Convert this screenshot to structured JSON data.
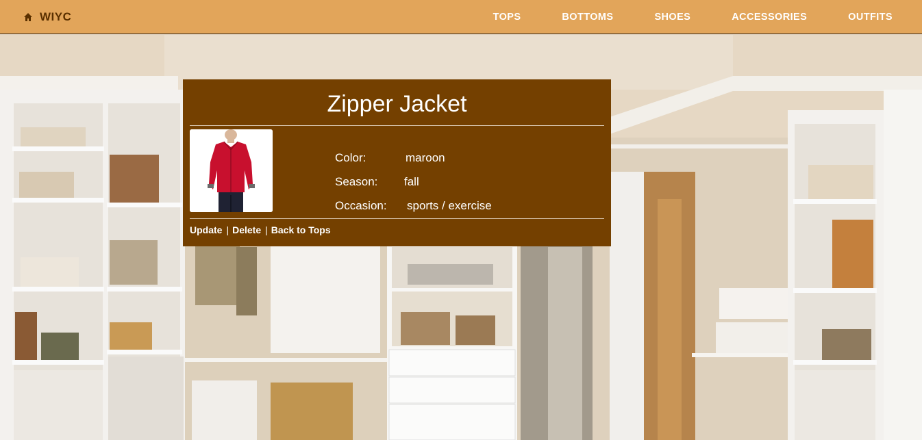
{
  "navbar": {
    "brand": "WIYC",
    "brand_icon": "home-icon",
    "links": [
      "TOPS",
      "BOTTOMS",
      "SHOES",
      "ACCESSORIES",
      "OUTFITS"
    ]
  },
  "colors": {
    "navbar_bg": "#e2a55a",
    "card_bg": "#744000",
    "item_color": "#c8102e"
  },
  "item": {
    "name": "Zipper Jacket",
    "image_alt": "red zipper jacket",
    "attributes": [
      {
        "label": "Color:",
        "value": "maroon"
      },
      {
        "label": "Season:",
        "value": "fall"
      },
      {
        "label": "Occasion:",
        "value": "sports / exercise"
      }
    ]
  },
  "actions": {
    "update": "Update",
    "delete": "Delete",
    "back": "Back to Tops",
    "separator": "|"
  }
}
